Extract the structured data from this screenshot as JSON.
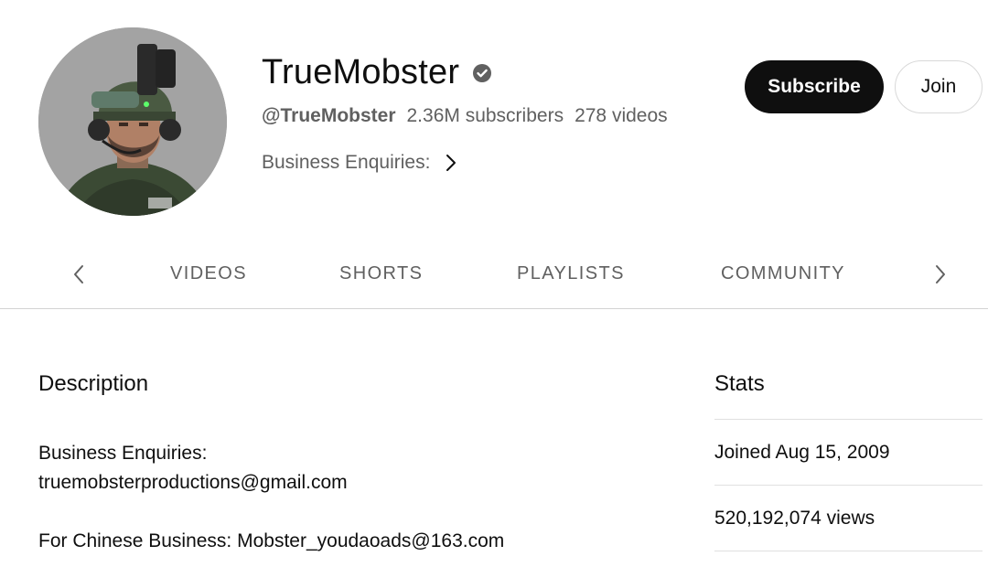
{
  "channel": {
    "name": "TrueMobster",
    "handle": "@TrueMobster",
    "subscribers": "2.36M subscribers",
    "videos": "278 videos",
    "link_label": "Business Enquiries:",
    "avatar_icon": "soldier-avatar-icon",
    "verified_icon": "verified-check-icon"
  },
  "actions": {
    "subscribe_label": "Subscribe",
    "join_label": "Join"
  },
  "tabs": {
    "items": [
      {
        "label": "VIDEOS"
      },
      {
        "label": "SHORTS"
      },
      {
        "label": "PLAYLISTS"
      },
      {
        "label": "COMMUNITY"
      }
    ],
    "prev_icon": "chevron-left-icon",
    "next_icon": "chevron-right-icon"
  },
  "description": {
    "title": "Description",
    "lines": [
      "Business Enquiries:",
      "truemobsterproductions@gmail.com",
      "For Chinese Business: Mobster_youdaoads@163.com"
    ]
  },
  "stats": {
    "title": "Stats",
    "joined": "Joined Aug 15, 2009",
    "views": "520,192,074 views"
  },
  "colors": {
    "subscribe_bg": "#0f0f0f",
    "secondary_text": "#606060",
    "divider": "#d3d3d3"
  }
}
